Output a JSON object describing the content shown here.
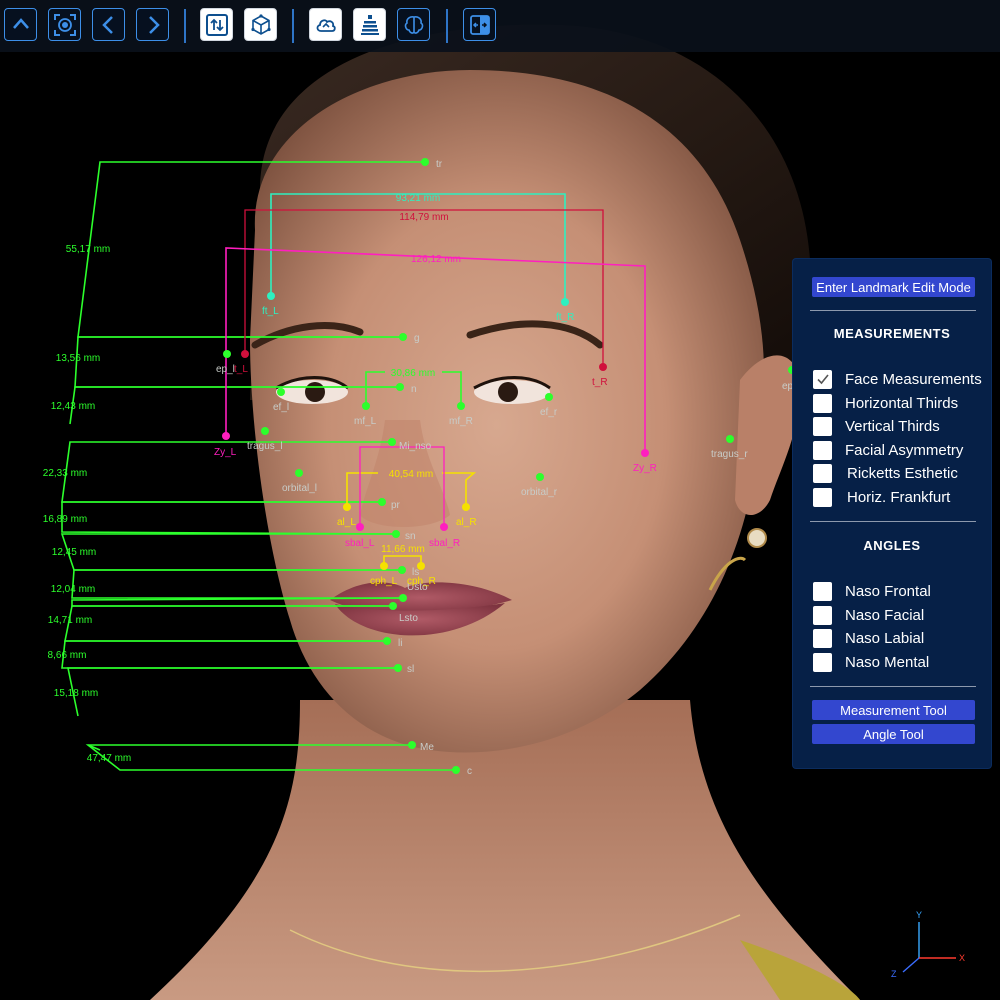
{
  "toolbar": {
    "buttons": [
      {
        "name": "collapse-up-button",
        "icon": "chevron-up-icon"
      },
      {
        "name": "focus-button",
        "icon": "focus-target-icon"
      },
      {
        "name": "previous-button",
        "icon": "chevron-left-icon"
      },
      {
        "name": "next-button",
        "icon": "chevron-right-icon"
      },
      {
        "name": "swap-button",
        "icon": "swap-arrows-icon"
      },
      {
        "name": "cube-view-button",
        "icon": "cube-icon"
      },
      {
        "name": "cloud-button",
        "icon": "cloud-icon"
      },
      {
        "name": "layers-button",
        "icon": "layers-icon"
      },
      {
        "name": "brain-button",
        "icon": "brain-icon"
      },
      {
        "name": "compare-button",
        "icon": "split-compare-icon"
      }
    ]
  },
  "panel": {
    "edit_mode_label": "Enter Landmark Edit Mode",
    "measurements_heading": "MEASUREMENTS",
    "measurements": [
      {
        "label": "Face Measurements",
        "checked": true
      },
      {
        "label": "Horizontal Thirds",
        "checked": false
      },
      {
        "label": "Vertical Thirds",
        "checked": false
      },
      {
        "label": "Facial Asymmetry",
        "checked": false
      },
      {
        "label": "Ricketts Esthetic",
        "checked": false
      },
      {
        "label": "Horiz. Frankfurt",
        "checked": false
      }
    ],
    "angles_heading": "ANGLES",
    "angles": [
      {
        "label": "Naso Frontal",
        "checked": false
      },
      {
        "label": "Naso Facial",
        "checked": false
      },
      {
        "label": "Naso Labial",
        "checked": false
      },
      {
        "label": "Naso Mental",
        "checked": false
      }
    ],
    "measurement_tool_label": "Measurement Tool",
    "angle_tool_label": "Angle Tool"
  },
  "colors": {
    "green": "#2cff2c",
    "cyan": "#2ef0c0",
    "magenta": "#ff1fbf",
    "crimson": "#d0103c",
    "yellow": "#f5e100",
    "label_gray": "#c8ccc8"
  },
  "landmarks": [
    {
      "label": "tr",
      "color": "green"
    },
    {
      "label": "g",
      "color": "green"
    },
    {
      "label": "n",
      "color": "green"
    },
    {
      "label": "Mi_nso",
      "color": "green"
    },
    {
      "label": "pr",
      "color": "green"
    },
    {
      "label": "sn",
      "color": "green"
    },
    {
      "label": "ls",
      "color": "green"
    },
    {
      "label": "Usto",
      "color": "green"
    },
    {
      "label": "Lsto",
      "color": "green"
    },
    {
      "label": "li",
      "color": "green"
    },
    {
      "label": "sl",
      "color": "green"
    },
    {
      "label": "Me",
      "color": "green"
    },
    {
      "label": "c",
      "color": "green"
    },
    {
      "label": "ft_L",
      "color": "cyan"
    },
    {
      "label": "ft_R",
      "color": "cyan"
    },
    {
      "label": "ep_l",
      "color": "green"
    },
    {
      "label": "ep_r",
      "color": "green"
    },
    {
      "label": "ef_l",
      "color": "green"
    },
    {
      "label": "ef_r",
      "color": "green"
    },
    {
      "label": "mf_L",
      "color": "green"
    },
    {
      "label": "mf_R",
      "color": "green"
    },
    {
      "label": "tragus_l",
      "color": "green"
    },
    {
      "label": "tragus_r",
      "color": "green"
    },
    {
      "label": "orbital_l",
      "color": "green"
    },
    {
      "label": "orbital_r",
      "color": "green"
    },
    {
      "label": "Zy_L",
      "color": "magenta"
    },
    {
      "label": "Zy_R",
      "color": "magenta"
    },
    {
      "label": "al_L",
      "color": "yellow"
    },
    {
      "label": "al_R",
      "color": "yellow"
    },
    {
      "label": "sbal_L",
      "color": "magenta"
    },
    {
      "label": "sbal_R",
      "color": "magenta"
    },
    {
      "label": "cph_L",
      "color": "yellow"
    },
    {
      "label": "cph_R",
      "color": "yellow"
    },
    {
      "label": "t_L",
      "color": "crimson"
    },
    {
      "label": "t_R",
      "color": "crimson"
    }
  ],
  "measurements": [
    {
      "id": "tr-g",
      "value": "55,17 mm",
      "color": "green"
    },
    {
      "id": "g-n",
      "value": "13,56 mm",
      "color": "green"
    },
    {
      "id": "n-mi",
      "value": "12,43 mm",
      "color": "green"
    },
    {
      "id": "mi-pr",
      "value": "22,33 mm",
      "color": "green"
    },
    {
      "id": "pr-sn",
      "value": "16,89 mm",
      "color": "green"
    },
    {
      "id": "sn-ls",
      "value": "12,45 mm",
      "color": "green"
    },
    {
      "id": "ls-lsto",
      "value": "12,04 mm",
      "color": "green"
    },
    {
      "id": "lsto-li",
      "value": "14,71 mm",
      "color": "green"
    },
    {
      "id": "li-sl",
      "value": "8,66 mm",
      "color": "green"
    },
    {
      "id": "sl-me",
      "value": "15,18 mm",
      "color": "green"
    },
    {
      "id": "me-c",
      "value": "47,47 mm",
      "color": "green"
    },
    {
      "id": "ft-ft",
      "value": "93,21 mm",
      "color": "cyan"
    },
    {
      "id": "t-t",
      "value": "114,79 mm",
      "color": "crimson"
    },
    {
      "id": "zy-zy",
      "value": "126,12 mm",
      "color": "magenta"
    },
    {
      "id": "mf-mf",
      "value": "30,86 mm",
      "color": "green"
    },
    {
      "id": "al-al",
      "value": "40,54 mm",
      "color": "yellow"
    },
    {
      "id": "cph-cph",
      "value": "11,66 mm",
      "color": "yellow"
    }
  ],
  "axes": {
    "x": "X",
    "y": "Y",
    "z": "Z"
  }
}
